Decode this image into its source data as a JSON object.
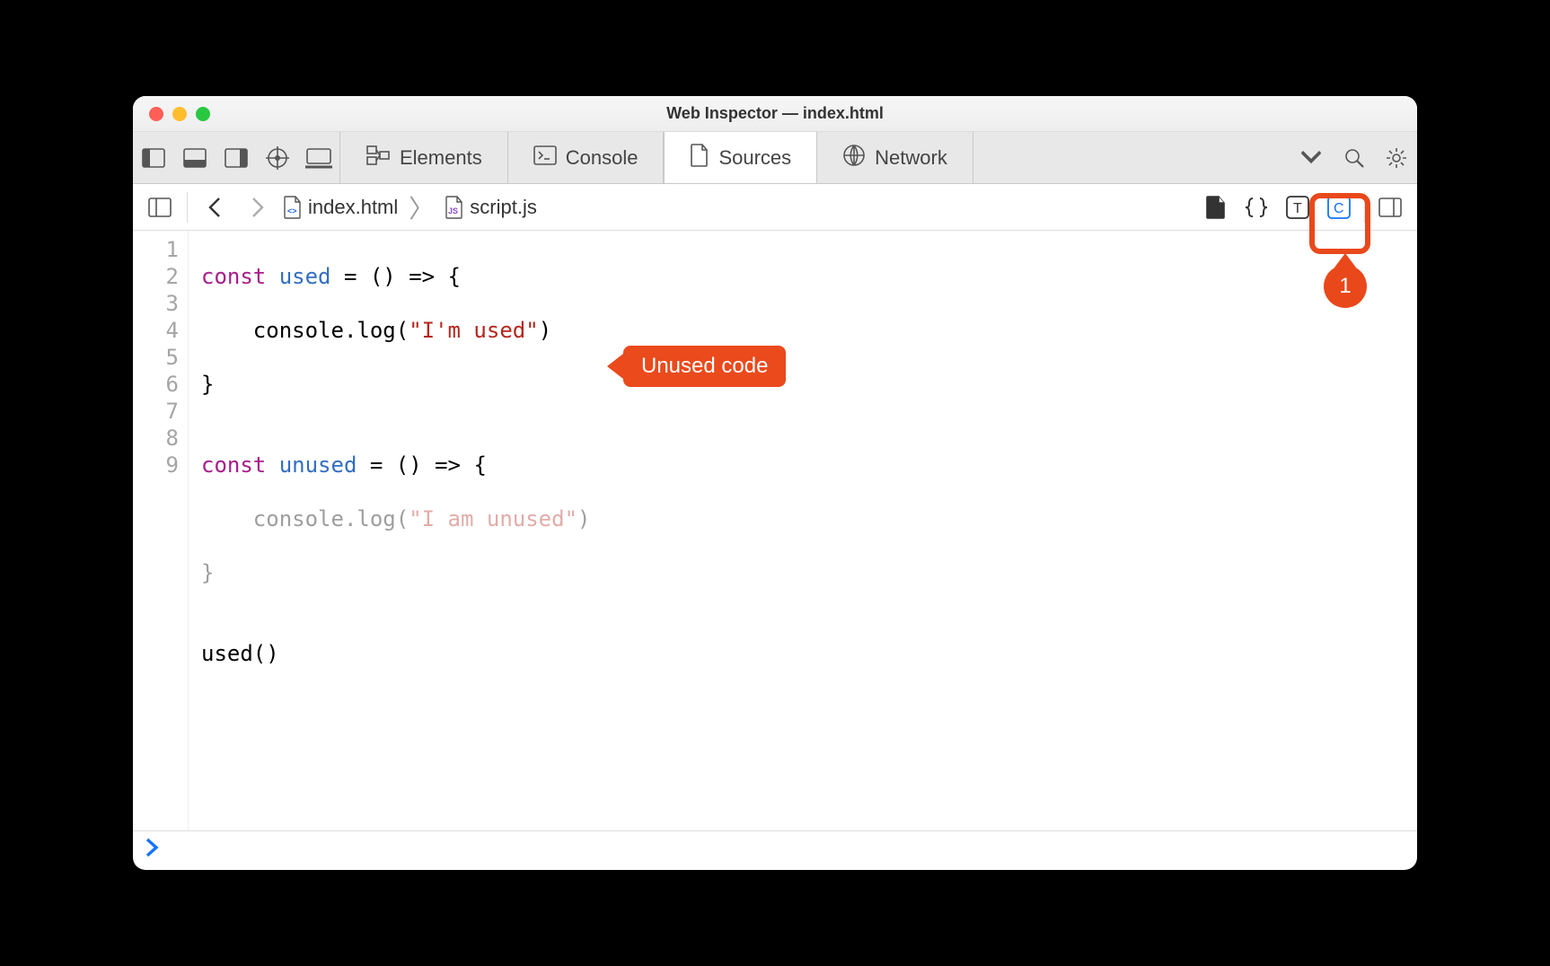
{
  "window": {
    "title": "Web Inspector — index.html"
  },
  "tabs": {
    "elements": "Elements",
    "console": "Console",
    "sources": "Sources",
    "network": "Network"
  },
  "breadcrumb": {
    "file1": "index.html",
    "file2": "script.js"
  },
  "annotations": {
    "unused_code": "Unused code",
    "coverage_step": "1"
  },
  "code": {
    "lines": [
      "1",
      "2",
      "3",
      "4",
      "5",
      "6",
      "7",
      "8",
      "9"
    ],
    "l1_kw": "const",
    "l1_id": "used",
    "l1_rest": " = () => {",
    "l2_pre": "    console.log(",
    "l2_str": "\"I'm used\"",
    "l2_post": ")",
    "l3": "}",
    "l4": "",
    "l5_kw": "const",
    "l5_id": "unused",
    "l5_rest": " = () => {",
    "l6_pre": "    console.log(",
    "l6_str": "\"I am unused\"",
    "l6_post": ")",
    "l7": "}",
    "l8": "",
    "l9": "used()"
  },
  "console_prompt": "›"
}
